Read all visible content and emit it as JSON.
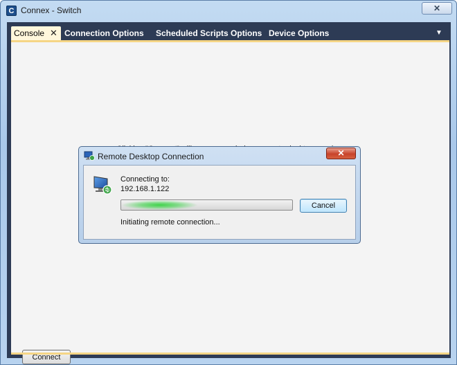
{
  "window": {
    "title": "Connex - Switch",
    "app_icon_letter": "C",
    "close_glyph": "✕"
  },
  "tabs": [
    {
      "label": "Console",
      "active": true,
      "close_glyph": "✕"
    },
    {
      "label": "Connection Options",
      "active": false
    },
    {
      "label": "Scheduled Scripts Options",
      "active": false
    },
    {
      "label": "Device Options",
      "active": false
    }
  ],
  "tab_overflow_glyph": "▼",
  "console": {
    "message": "Clicking \"Connect\" will open up a windows remote desktop session.",
    "connect_label": "Connect"
  },
  "dialog": {
    "title": "Remote Desktop Connection",
    "close_glyph": "✕",
    "connecting_to_label": "Connecting to:",
    "address": "192.168.1.122",
    "status": "Initiating remote connection...",
    "cancel_label": "Cancel",
    "progress_fraction": 0.45
  },
  "colors": {
    "tab_accent": "#f5d585",
    "frame": "#2d3b55",
    "progress_glow": "#3fd34b"
  },
  "icons": {
    "app": "app-logo-icon",
    "dialog": "remote-desktop-icon",
    "monitor": "monitor-connection-icon"
  }
}
